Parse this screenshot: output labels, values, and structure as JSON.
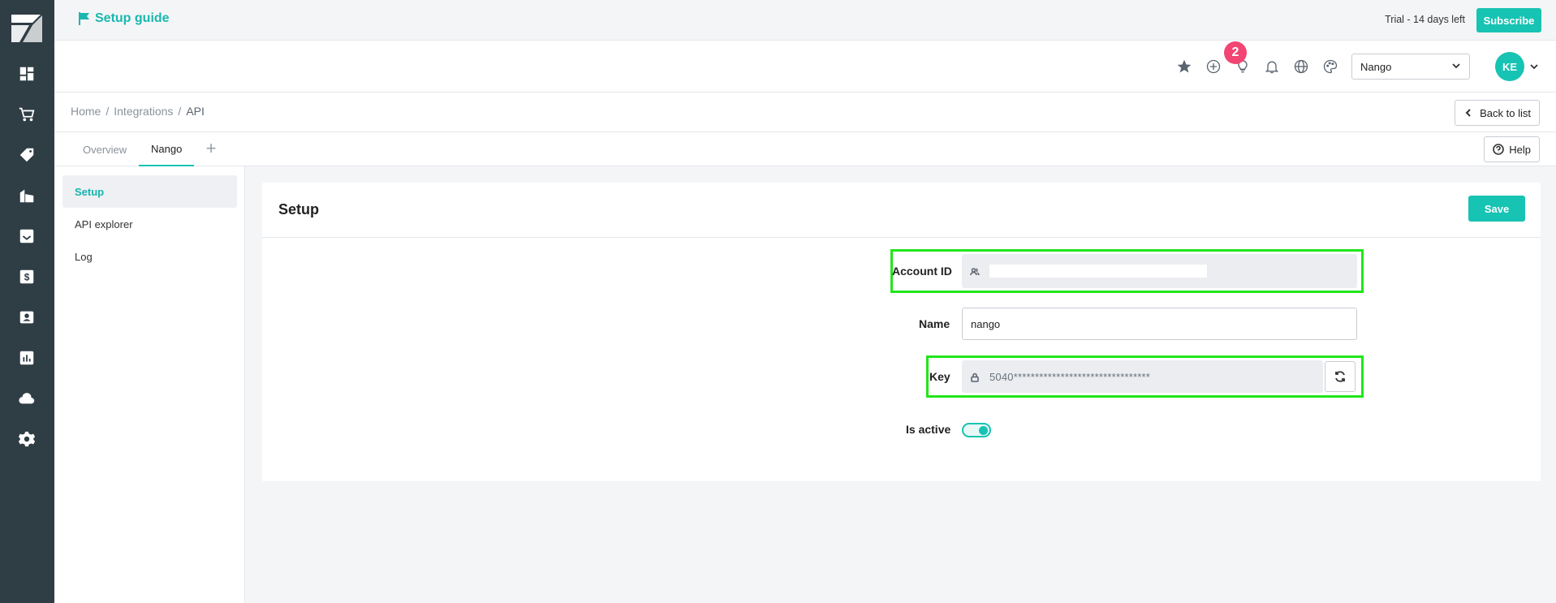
{
  "topbar": {
    "setup_guide": "Setup guide",
    "trial": "Trial - 14 days left",
    "subscribe": "Subscribe"
  },
  "header": {
    "notifications_badge": "2",
    "org_select": "Nango",
    "avatar_initials": "KE",
    "icons": [
      "star-icon",
      "add-circle-icon",
      "lightbulb-icon",
      "bell-icon",
      "globe-icon",
      "palette-icon"
    ]
  },
  "breadcrumb": {
    "home": "Home",
    "integrations": "Integrations",
    "current": "API",
    "sep": "/"
  },
  "actions": {
    "back": "Back to list",
    "help": "Help",
    "save": "Save"
  },
  "tabs": [
    {
      "label": "Overview",
      "active": false
    },
    {
      "label": "Nango",
      "active": true
    }
  ],
  "sidenav": [
    {
      "label": "Setup",
      "active": true
    },
    {
      "label": "API explorer",
      "active": false
    },
    {
      "label": "Log",
      "active": false
    }
  ],
  "form": {
    "title": "Setup",
    "account_id_label": "Account ID",
    "name_label": "Name",
    "name_value": "nango",
    "key_label": "Key",
    "key_value": "5040********************************",
    "active_label": "Is active",
    "is_active": true
  },
  "colors": {
    "accent": "#17c3b2",
    "rail": "#2f3d45",
    "badge": "#f24573",
    "highlight": "#22e51b"
  }
}
